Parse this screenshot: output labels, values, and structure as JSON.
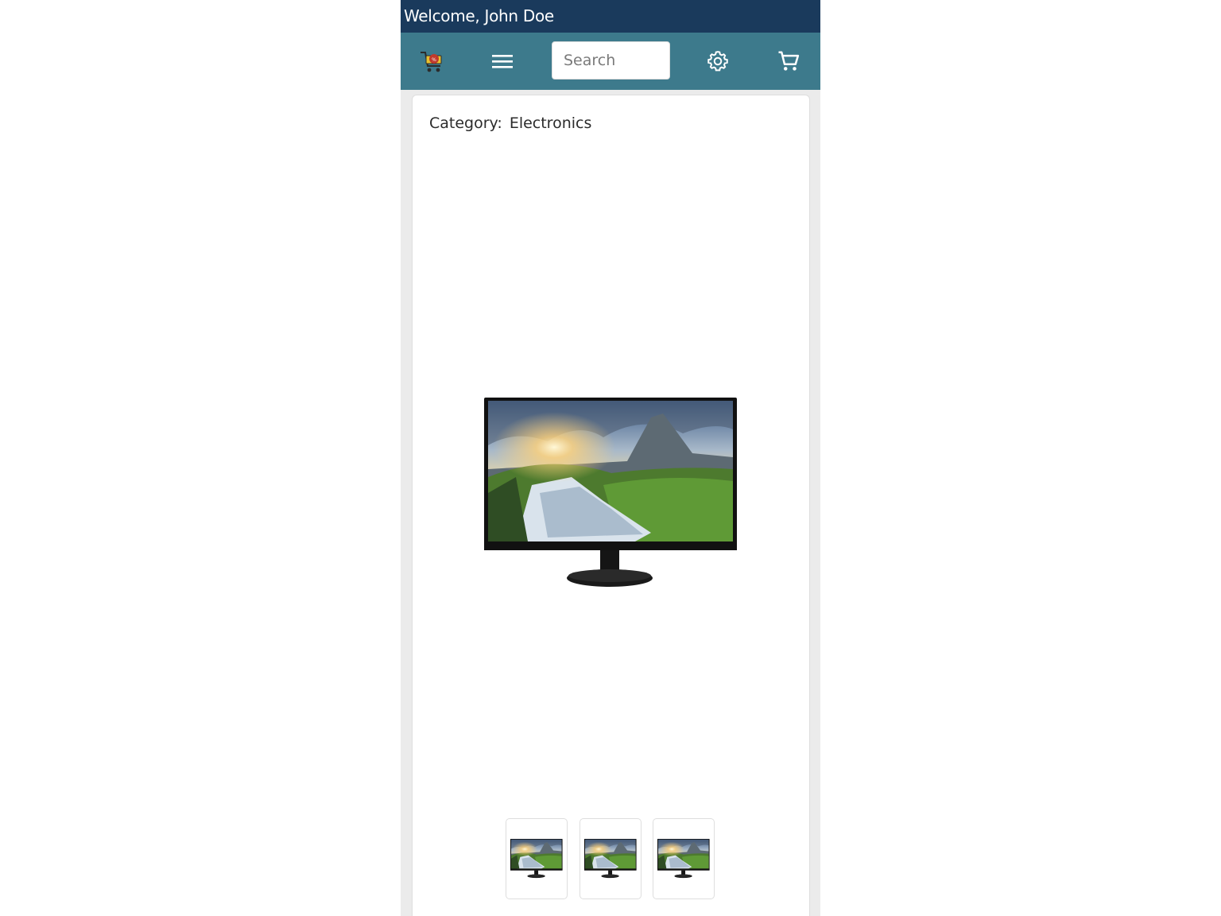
{
  "header": {
    "welcome_text": "Welcome, John Doe"
  },
  "nav": {
    "search_placeholder": "Search",
    "icons": [
      "shopping-cart-logo-icon",
      "hamburger-menu-icon",
      "gear-icon",
      "cart-icon"
    ]
  },
  "product": {
    "category_label": "Category:",
    "category_value": "Electronics",
    "image_description_icon": "monitor-image",
    "thumbnails": [
      "monitor-thumbnail",
      "monitor-thumbnail",
      "monitor-thumbnail"
    ]
  },
  "colors": {
    "welcome_bar": "#1a3a5c",
    "nav_bar": "#3d7a8c",
    "page_background": "#ebebeb"
  }
}
